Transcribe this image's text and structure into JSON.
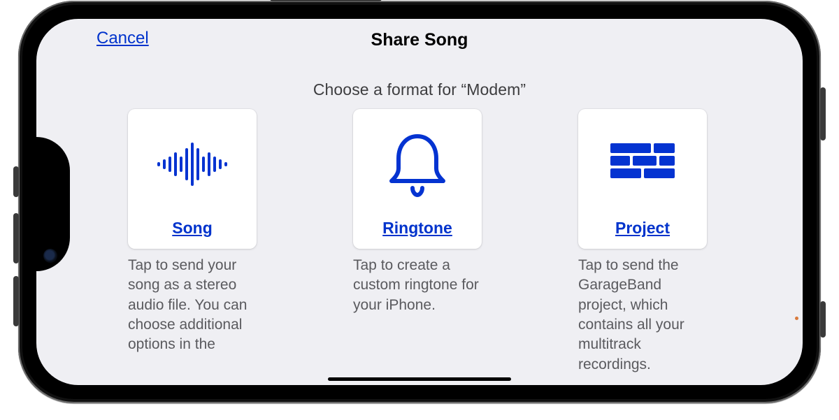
{
  "header": {
    "cancel_label": "Cancel",
    "title": "Share Song"
  },
  "subtitle": "Choose a format for “Modem”",
  "accent_color": "#0033cc",
  "icon_blue": "#0433d1",
  "options": [
    {
      "label": "Song",
      "icon": "waveform-icon",
      "description": "Tap to send your song as a stereo audio file. You can choose additional options in the"
    },
    {
      "label": "Ringtone",
      "icon": "bell-icon",
      "description": "Tap to create a custom ringtone for your iPhone."
    },
    {
      "label": "Project",
      "icon": "bricks-icon",
      "description": "Tap to send the GarageBand project, which contains all your multitrack recordings."
    }
  ]
}
